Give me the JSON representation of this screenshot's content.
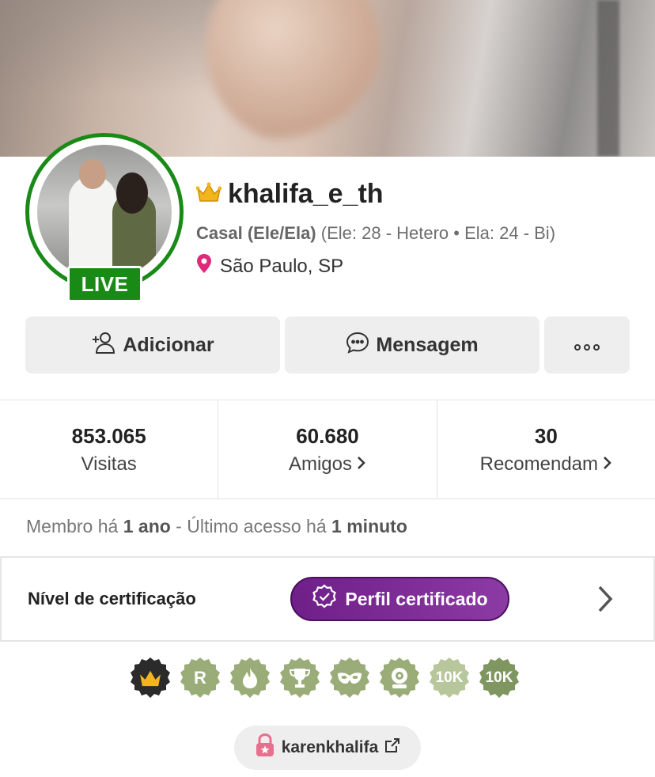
{
  "profile": {
    "username": "khalifa_e_th",
    "type": "Casal (Ele/Ela)",
    "details": "(Ele: 28 - Hetero • Ela: 24 - Bi)",
    "location": "São Paulo, SP",
    "live_label": "LIVE"
  },
  "actions": {
    "add_label": "Adicionar",
    "message_label": "Mensagem"
  },
  "stats": [
    {
      "value": "853.065",
      "label": "Visitas"
    },
    {
      "value": "60.680",
      "label": "Amigos"
    },
    {
      "value": "30",
      "label": "Recomendam"
    }
  ],
  "member": {
    "prefix": "Membro há ",
    "since": "1 ano",
    "mid": " - Último acesso há ",
    "last": "1 minuto"
  },
  "certification": {
    "label": "Nível de certificação",
    "status": "Perfil certificado"
  },
  "badges": [
    {
      "icon": "crown-icon",
      "text": ""
    },
    {
      "icon": "r-icon",
      "text": "R"
    },
    {
      "icon": "flame-icon",
      "text": ""
    },
    {
      "icon": "trophy-icon",
      "text": ""
    },
    {
      "icon": "mask-icon",
      "text": ""
    },
    {
      "icon": "webcam-icon",
      "text": ""
    },
    {
      "icon": "10k-icon",
      "text": "10K"
    },
    {
      "icon": "10k-icon",
      "text": "10K"
    }
  ],
  "social": {
    "handle": "karenkhalifa"
  },
  "colors": {
    "live_green": "#1a8a17",
    "cert_purple": "#7a2a93",
    "badge_green": "#9aad78",
    "pin_pink": "#e0297a"
  }
}
